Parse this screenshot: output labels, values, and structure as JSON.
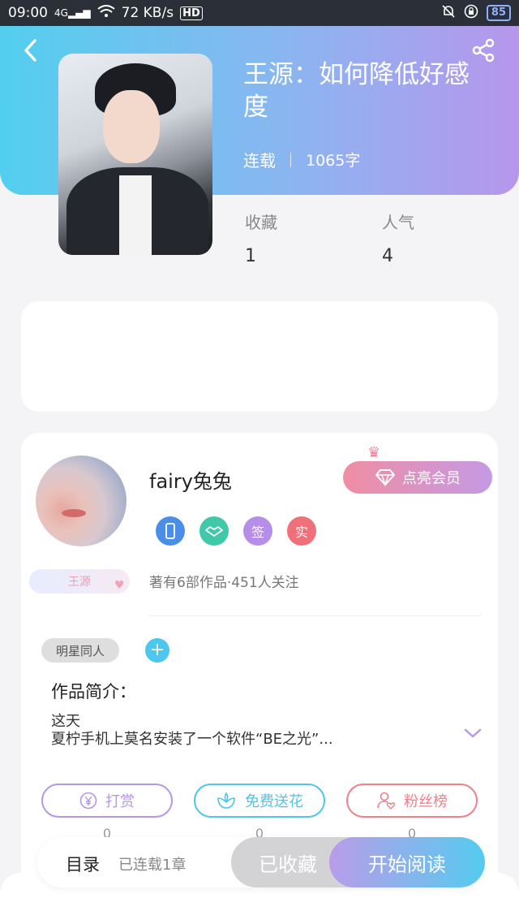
{
  "status_bar": {
    "time": "09:00",
    "network": "4G",
    "speed": "72 KB/s",
    "hd": "HD",
    "battery": "85"
  },
  "header": {
    "back_icon": "chevron-left-icon",
    "share_icon": "share-icon"
  },
  "book": {
    "title": "王源：如何降低好感度",
    "status": "连载",
    "word_count": "1065字"
  },
  "stats": {
    "favorites_label": "收藏",
    "favorites_value": "1",
    "popularity_label": "人气",
    "popularity_value": "4"
  },
  "author": {
    "name": "fairy兔兔",
    "avatar_tag": "王源",
    "vip_button": "点亮会员",
    "badges": [
      {
        "icon": "phone-icon",
        "color": "#4a8ee8"
      },
      {
        "icon": "handshake-icon",
        "color": "#3fc9a8"
      },
      {
        "label": "签",
        "color": "#b68de8"
      },
      {
        "label": "实",
        "color": "#f0707a"
      }
    ],
    "summary": "著有6部作品·451人关注"
  },
  "intro": {
    "tag": "明星同人",
    "add_icon": "plus-icon",
    "title": "作品简介：",
    "line1": "这天",
    "line2": "夏柠手机上莫名安装了一个软件“BE之光”...",
    "expand_icon": "chevron-down-icon"
  },
  "actions": [
    {
      "label": "打赏",
      "icon": "yen-icon",
      "color": "#b697e6",
      "count": "0"
    },
    {
      "label": "免费送花",
      "icon": "flower-icon",
      "color": "#4cc6ea",
      "count": "0"
    },
    {
      "label": "粉丝榜",
      "icon": "fan-icon",
      "color": "#ef7f88",
      "count": "0"
    }
  ],
  "bottom": {
    "toc": "目录",
    "toc_sub": "已连载1章",
    "favorited": "已收藏",
    "read": "开始阅读"
  },
  "colors": {
    "header_gradient_start": "#52cfee",
    "header_gradient_end": "#b796ec",
    "accent_pink": "#f08da2",
    "accent_blue": "#4dc7ee"
  }
}
